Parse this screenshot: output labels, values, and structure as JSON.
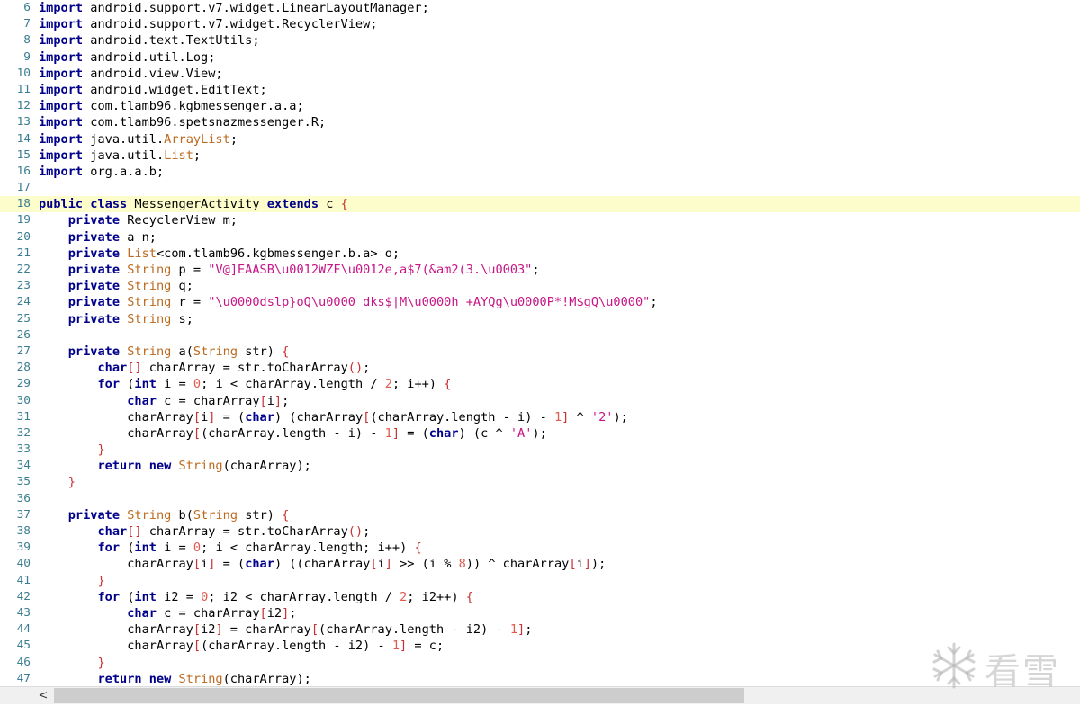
{
  "editor": {
    "highlighted_line": 18,
    "lines": [
      {
        "n": "6",
        "tokens": [
          [
            "k",
            "import"
          ],
          [
            "",
            " android.support.v7.widget.LinearLayoutManager;"
          ]
        ]
      },
      {
        "n": "7",
        "tokens": [
          [
            "k",
            "import"
          ],
          [
            "",
            " android.support.v7.widget.RecyclerView;"
          ]
        ]
      },
      {
        "n": "8",
        "tokens": [
          [
            "k",
            "import"
          ],
          [
            "",
            " android.text.TextUtils;"
          ]
        ]
      },
      {
        "n": "9",
        "tokens": [
          [
            "k",
            "import"
          ],
          [
            "",
            " android.util.Log;"
          ]
        ]
      },
      {
        "n": "10",
        "tokens": [
          [
            "k",
            "import"
          ],
          [
            "",
            " android.view.View;"
          ]
        ]
      },
      {
        "n": "11",
        "tokens": [
          [
            "k",
            "import"
          ],
          [
            "",
            " android.widget.EditText;"
          ]
        ]
      },
      {
        "n": "12",
        "tokens": [
          [
            "k",
            "import"
          ],
          [
            "",
            " com.tlamb96.kgbmessenger.a.a;"
          ]
        ]
      },
      {
        "n": "13",
        "tokens": [
          [
            "k",
            "import"
          ],
          [
            "",
            " com.tlamb96.spetsnazmessenger.R;"
          ]
        ]
      },
      {
        "n": "14",
        "tokens": [
          [
            "k",
            "import"
          ],
          [
            "",
            " java.util."
          ],
          [
            "t",
            "ArrayList"
          ],
          [
            "",
            ";"
          ]
        ]
      },
      {
        "n": "15",
        "tokens": [
          [
            "k",
            "import"
          ],
          [
            "",
            " java.util."
          ],
          [
            "t",
            "List"
          ],
          [
            "",
            ";"
          ]
        ]
      },
      {
        "n": "16",
        "tokens": [
          [
            "k",
            "import"
          ],
          [
            "",
            " org.a.a.b;"
          ]
        ]
      },
      {
        "n": "17",
        "tokens": []
      },
      {
        "n": "18",
        "tokens": [
          [
            "k",
            "public class"
          ],
          [
            "",
            " MessengerActivity "
          ],
          [
            "k",
            "extends"
          ],
          [
            "",
            " c "
          ],
          [
            "p",
            "{"
          ]
        ]
      },
      {
        "n": "19",
        "tokens": [
          [
            "",
            "    "
          ],
          [
            "k",
            "private"
          ],
          [
            "",
            " RecyclerView m;"
          ]
        ]
      },
      {
        "n": "20",
        "tokens": [
          [
            "",
            "    "
          ],
          [
            "k",
            "private"
          ],
          [
            "",
            " a n;"
          ]
        ]
      },
      {
        "n": "21",
        "tokens": [
          [
            "",
            "    "
          ],
          [
            "k",
            "private"
          ],
          [
            "",
            " "
          ],
          [
            "t",
            "List"
          ],
          [
            "",
            "<com.tlamb96.kgbmessenger.b.a> o;"
          ]
        ]
      },
      {
        "n": "22",
        "tokens": [
          [
            "",
            "    "
          ],
          [
            "k",
            "private"
          ],
          [
            "",
            " "
          ],
          [
            "t",
            "String"
          ],
          [
            "",
            " p = "
          ],
          [
            "s",
            "\"V@]EAASB\\u0012WZF\\u0012e,a$7(&am2(3.\\u0003\""
          ],
          [
            "",
            ";"
          ]
        ]
      },
      {
        "n": "23",
        "tokens": [
          [
            "",
            "    "
          ],
          [
            "k",
            "private"
          ],
          [
            "",
            " "
          ],
          [
            "t",
            "String"
          ],
          [
            "",
            " q;"
          ]
        ]
      },
      {
        "n": "24",
        "tokens": [
          [
            "",
            "    "
          ],
          [
            "k",
            "private"
          ],
          [
            "",
            " "
          ],
          [
            "t",
            "String"
          ],
          [
            "",
            " r = "
          ],
          [
            "s",
            "\"\\u0000dslp}oQ\\u0000 dks$|M\\u0000h +AYQg\\u0000P*!M$gQ\\u0000\""
          ],
          [
            "",
            ";"
          ]
        ]
      },
      {
        "n": "25",
        "tokens": [
          [
            "",
            "    "
          ],
          [
            "k",
            "private"
          ],
          [
            "",
            " "
          ],
          [
            "t",
            "String"
          ],
          [
            "",
            " s;"
          ]
        ]
      },
      {
        "n": "26",
        "tokens": []
      },
      {
        "n": "27",
        "tokens": [
          [
            "",
            "    "
          ],
          [
            "k",
            "private"
          ],
          [
            "",
            " "
          ],
          [
            "t",
            "String"
          ],
          [
            "",
            " a("
          ],
          [
            "t",
            "String"
          ],
          [
            "",
            " str) "
          ],
          [
            "p",
            "{"
          ]
        ]
      },
      {
        "n": "28",
        "tokens": [
          [
            "",
            "        "
          ],
          [
            "k",
            "char"
          ],
          [
            "p",
            "[]"
          ],
          [
            "",
            " charArray = str.toCharArray"
          ],
          [
            "p",
            "()"
          ],
          [
            "",
            ";"
          ]
        ]
      },
      {
        "n": "29",
        "tokens": [
          [
            "",
            "        "
          ],
          [
            "k",
            "for"
          ],
          [
            "",
            " ("
          ],
          [
            "k",
            "int"
          ],
          [
            "",
            " i = "
          ],
          [
            "n",
            "0"
          ],
          [
            "",
            "; i < charArray.length / "
          ],
          [
            "n",
            "2"
          ],
          [
            "",
            "; i++) "
          ],
          [
            "p",
            "{"
          ]
        ]
      },
      {
        "n": "30",
        "tokens": [
          [
            "",
            "            "
          ],
          [
            "k",
            "char"
          ],
          [
            "",
            " c = charArray"
          ],
          [
            "p",
            "["
          ],
          [
            "",
            "i"
          ],
          [
            "p",
            "]"
          ],
          [
            "",
            ";"
          ]
        ]
      },
      {
        "n": "31",
        "tokens": [
          [
            "",
            "            charArray"
          ],
          [
            "p",
            "["
          ],
          [
            "",
            "i"
          ],
          [
            "p",
            "]"
          ],
          [
            "",
            " = ("
          ],
          [
            "k",
            "char"
          ],
          [
            "",
            ") (charArray"
          ],
          [
            "p",
            "["
          ],
          [
            "",
            "(charArray.length - i) - "
          ],
          [
            "n",
            "1"
          ],
          [
            "p",
            "]"
          ],
          [
            "",
            " ^ "
          ],
          [
            "s",
            "'2'"
          ],
          [
            "",
            ");"
          ]
        ]
      },
      {
        "n": "32",
        "tokens": [
          [
            "",
            "            charArray"
          ],
          [
            "p",
            "["
          ],
          [
            "",
            "(charArray.length - i) - "
          ],
          [
            "n",
            "1"
          ],
          [
            "p",
            "]"
          ],
          [
            "",
            " = ("
          ],
          [
            "k",
            "char"
          ],
          [
            "",
            ") (c ^ "
          ],
          [
            "s",
            "'A'"
          ],
          [
            "",
            ");"
          ]
        ]
      },
      {
        "n": "33",
        "tokens": [
          [
            "",
            "        "
          ],
          [
            "p",
            "}"
          ]
        ]
      },
      {
        "n": "34",
        "tokens": [
          [
            "",
            "        "
          ],
          [
            "k",
            "return new"
          ],
          [
            "",
            " "
          ],
          [
            "t",
            "String"
          ],
          [
            "",
            "(charArray);"
          ]
        ]
      },
      {
        "n": "35",
        "tokens": [
          [
            "",
            "    "
          ],
          [
            "p",
            "}"
          ]
        ]
      },
      {
        "n": "36",
        "tokens": []
      },
      {
        "n": "37",
        "tokens": [
          [
            "",
            "    "
          ],
          [
            "k",
            "private"
          ],
          [
            "",
            " "
          ],
          [
            "t",
            "String"
          ],
          [
            "",
            " b("
          ],
          [
            "t",
            "String"
          ],
          [
            "",
            " str) "
          ],
          [
            "p",
            "{"
          ]
        ]
      },
      {
        "n": "38",
        "tokens": [
          [
            "",
            "        "
          ],
          [
            "k",
            "char"
          ],
          [
            "p",
            "[]"
          ],
          [
            "",
            " charArray = str.toCharArray"
          ],
          [
            "p",
            "()"
          ],
          [
            "",
            ";"
          ]
        ]
      },
      {
        "n": "39",
        "tokens": [
          [
            "",
            "        "
          ],
          [
            "k",
            "for"
          ],
          [
            "",
            " ("
          ],
          [
            "k",
            "int"
          ],
          [
            "",
            " i = "
          ],
          [
            "n",
            "0"
          ],
          [
            "",
            "; i < charArray.length; i++) "
          ],
          [
            "p",
            "{"
          ]
        ]
      },
      {
        "n": "40",
        "tokens": [
          [
            "",
            "            charArray"
          ],
          [
            "p",
            "["
          ],
          [
            "",
            "i"
          ],
          [
            "p",
            "]"
          ],
          [
            "",
            " = ("
          ],
          [
            "k",
            "char"
          ],
          [
            "",
            ") ((charArray"
          ],
          [
            "p",
            "["
          ],
          [
            "",
            "i"
          ],
          [
            "p",
            "]"
          ],
          [
            "",
            " >> (i % "
          ],
          [
            "n",
            "8"
          ],
          [
            "",
            ")) ^ charArray"
          ],
          [
            "p",
            "["
          ],
          [
            "",
            "i"
          ],
          [
            "p",
            "]"
          ],
          [
            "",
            ");"
          ]
        ]
      },
      {
        "n": "41",
        "tokens": [
          [
            "",
            "        "
          ],
          [
            "p",
            "}"
          ]
        ]
      },
      {
        "n": "42",
        "tokens": [
          [
            "",
            "        "
          ],
          [
            "k",
            "for"
          ],
          [
            "",
            " ("
          ],
          [
            "k",
            "int"
          ],
          [
            "",
            " i2 = "
          ],
          [
            "n",
            "0"
          ],
          [
            "",
            "; i2 < charArray.length / "
          ],
          [
            "n",
            "2"
          ],
          [
            "",
            "; i2++) "
          ],
          [
            "p",
            "{"
          ]
        ]
      },
      {
        "n": "43",
        "tokens": [
          [
            "",
            "            "
          ],
          [
            "k",
            "char"
          ],
          [
            "",
            " c = charArray"
          ],
          [
            "p",
            "["
          ],
          [
            "",
            "i2"
          ],
          [
            "p",
            "]"
          ],
          [
            "",
            ";"
          ]
        ]
      },
      {
        "n": "44",
        "tokens": [
          [
            "",
            "            charArray"
          ],
          [
            "p",
            "["
          ],
          [
            "",
            "i2"
          ],
          [
            "p",
            "]"
          ],
          [
            "",
            " = charArray"
          ],
          [
            "p",
            "["
          ],
          [
            "",
            "(charArray.length - i2) - "
          ],
          [
            "n",
            "1"
          ],
          [
            "p",
            "]"
          ],
          [
            "",
            ";"
          ]
        ]
      },
      {
        "n": "45",
        "tokens": [
          [
            "",
            "            charArray"
          ],
          [
            "p",
            "["
          ],
          [
            "",
            "(charArray.length - i2) - "
          ],
          [
            "n",
            "1"
          ],
          [
            "p",
            "]"
          ],
          [
            "",
            " = c;"
          ]
        ]
      },
      {
        "n": "46",
        "tokens": [
          [
            "",
            "        "
          ],
          [
            "p",
            "}"
          ]
        ]
      },
      {
        "n": "47",
        "tokens": [
          [
            "",
            "        "
          ],
          [
            "k",
            "return new"
          ],
          [
            "",
            " "
          ],
          [
            "t",
            "String"
          ],
          [
            "",
            "(charArray);"
          ]
        ]
      }
    ]
  },
  "scrollbar": {
    "left_arrow": "<"
  },
  "watermark": {
    "text": "看雪",
    "icon": "snowflake-icon"
  }
}
